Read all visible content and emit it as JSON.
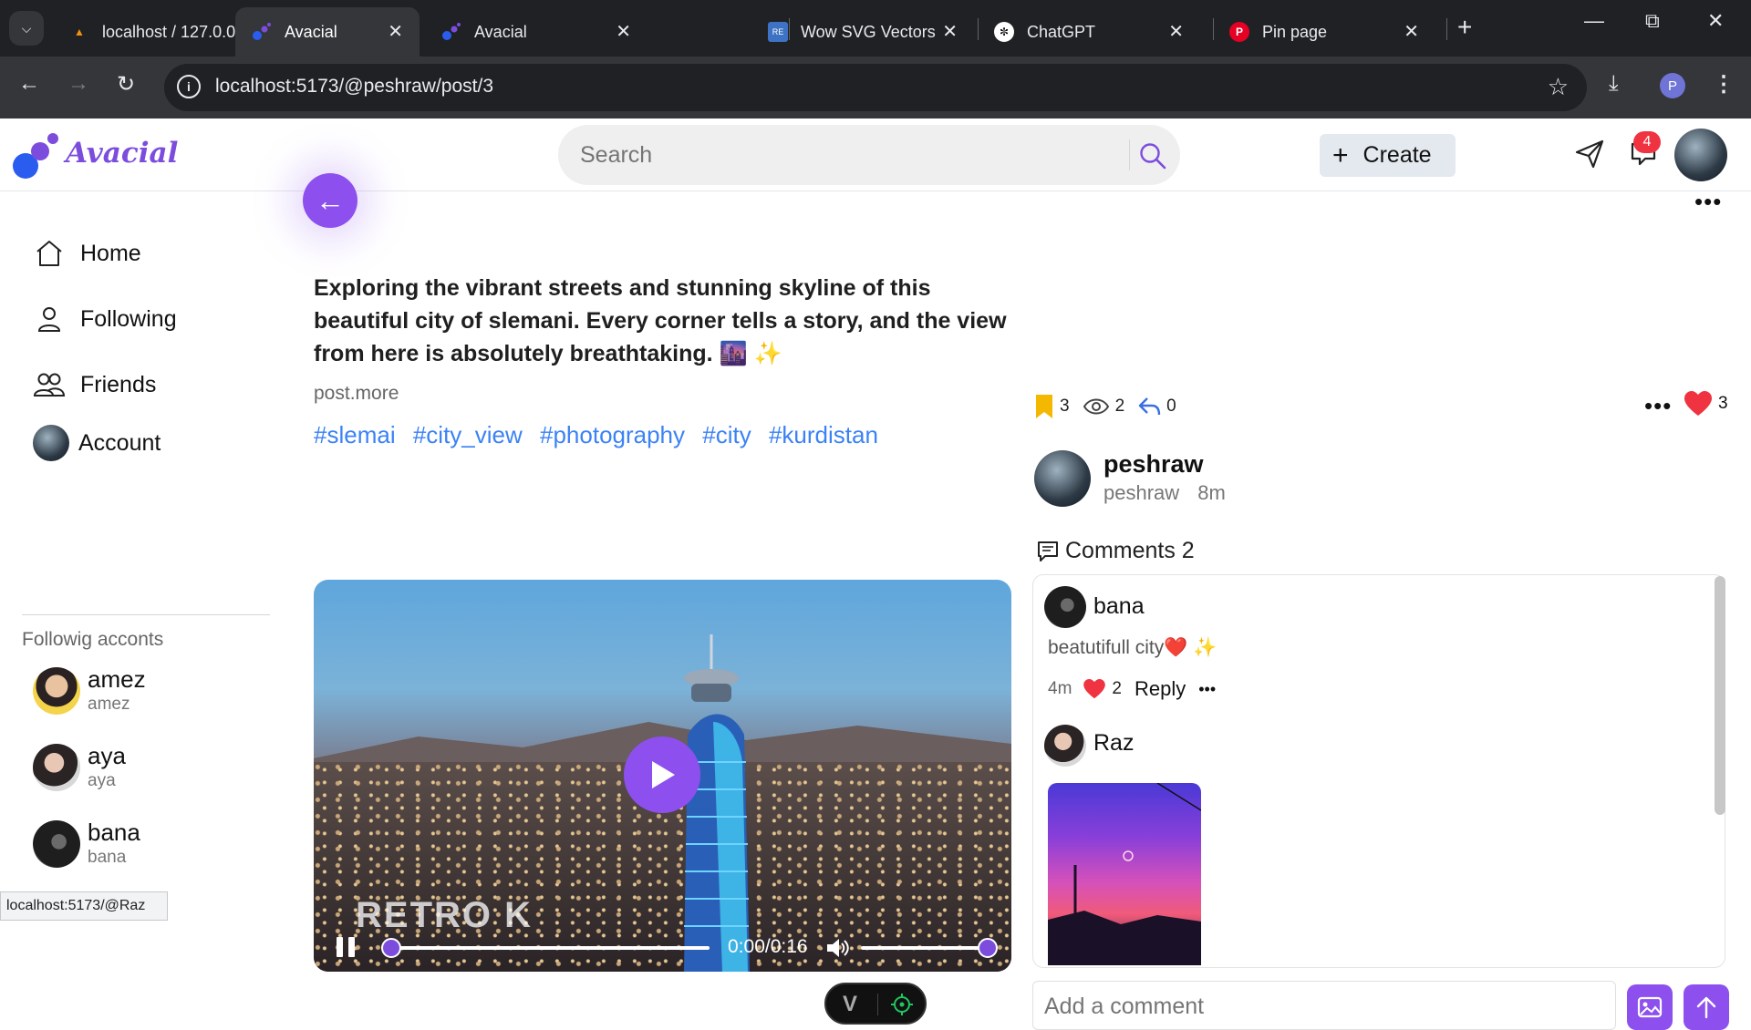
{
  "browser": {
    "tabs": [
      {
        "title": "localhost / 127.0.0.",
        "icon": "phpmyadmin-icon",
        "active": false
      },
      {
        "title": "Avacial",
        "icon": "avacial-icon",
        "active": true
      },
      {
        "title": "Avacial",
        "icon": "avacial-icon",
        "active": false
      },
      {
        "title": "Wow SVG Vectors",
        "icon": "svgrepo-icon",
        "active": false
      },
      {
        "title": "ChatGPT",
        "icon": "chatgpt-icon",
        "active": false
      },
      {
        "title": "Pin page",
        "icon": "pinterest-icon",
        "active": false
      }
    ],
    "url": "localhost:5173/@peshraw/post/3",
    "profile_initial": "P",
    "status_url": "localhost:5173/@Raz"
  },
  "header": {
    "brand": "Avacial",
    "search_placeholder": "Search",
    "create_label": "Create",
    "notification_count": "4",
    "colors": {
      "accent": "#8d50ee",
      "brand_text": "#7c4ddd",
      "link": "#3b82f6",
      "badge": "#ef3340"
    }
  },
  "sidebar": {
    "nav": [
      {
        "label": "Home",
        "icon": "home-icon"
      },
      {
        "label": "Following",
        "icon": "user-icon"
      },
      {
        "label": "Friends",
        "icon": "friends-icon"
      },
      {
        "label": "Account",
        "icon": "avatar"
      }
    ],
    "following_title": "Followig acconts",
    "accounts": [
      {
        "name": "amez",
        "handle": "amez"
      },
      {
        "name": "aya",
        "handle": "aya"
      },
      {
        "name": "bana",
        "handle": "bana"
      }
    ]
  },
  "post": {
    "text": "Exploring the vibrant streets and stunning skyline of this beautiful city of slemani. Every corner tells a story, and the view from here is absolutely breathtaking. 🌆 ✨",
    "more_label": "post.more",
    "tags": [
      "#slemai",
      "#city_view",
      "#photography",
      "#city",
      "#kurdistan"
    ],
    "video": {
      "watermark": "RETRO K",
      "time": "0:00/0:16",
      "progress": 0,
      "volume": 1
    },
    "stats": {
      "saves": "3",
      "views": "2",
      "shares": "0",
      "likes": "3"
    },
    "author": {
      "name": "peshraw",
      "handle": "peshraw",
      "time": "8m"
    }
  },
  "comments": {
    "title": "Comments 2",
    "items": [
      {
        "name": "bana",
        "text": "beatutifull city❤️ ✨",
        "time": "4m",
        "likes": "2",
        "reply_label": "Reply"
      },
      {
        "name": "Raz"
      }
    ],
    "input_placeholder": "Add a comment"
  }
}
